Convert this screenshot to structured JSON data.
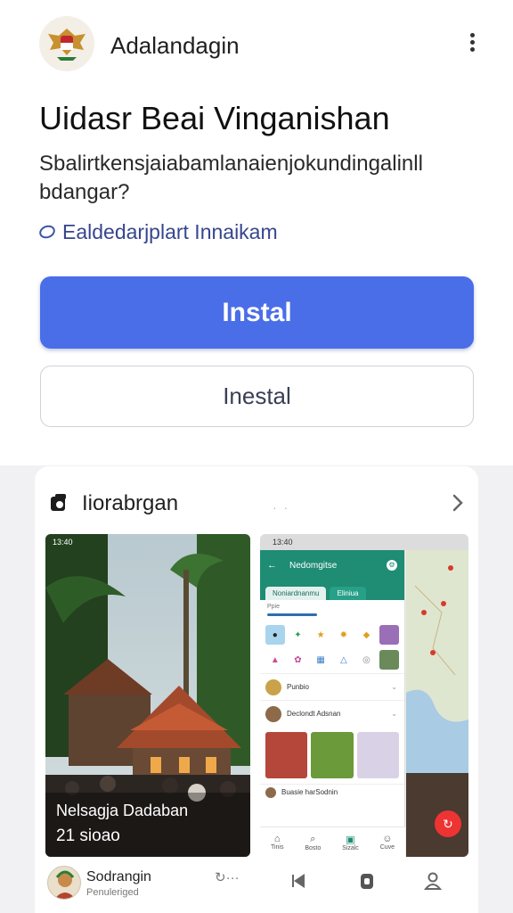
{
  "app": {
    "name": "Adalandagin"
  },
  "headline": "Uidasr Beai Vinganishan",
  "subtitle": "Sbalirtkensjaiabamlanaienjokundingalinll bdangar?",
  "link": {
    "text": "Ealdedarjplart Innaikam",
    "icon": "link-icon"
  },
  "buttons": {
    "primary": "Instal",
    "secondary": "Inestal"
  },
  "card": {
    "title": "Iiorabrgan",
    "more_dots": "· ·",
    "screenshot1": {
      "time": "13:40",
      "caption_title": "Nelsagja Dadaban",
      "caption_sub": "21 sioao"
    },
    "screenshot2": {
      "time": "13:40",
      "header_title": "Nedomgitse",
      "tabs": [
        "Noniardnanmu",
        "Eliniua"
      ],
      "subheader": "Ppie",
      "list_items": [
        "Punbio",
        "Declondt Adsnan"
      ],
      "last_item": "Buasie harSodnin",
      "nav": [
        "Tinis",
        "Bosto",
        "Sizalc",
        "Cuve"
      ]
    }
  },
  "footer": {
    "title": "Sodrangin",
    "subtitle": "Penuleriged",
    "share_glyph": "↻···"
  },
  "colors": {
    "accent": "#4a6ee8",
    "teal": "#1f8c74"
  }
}
